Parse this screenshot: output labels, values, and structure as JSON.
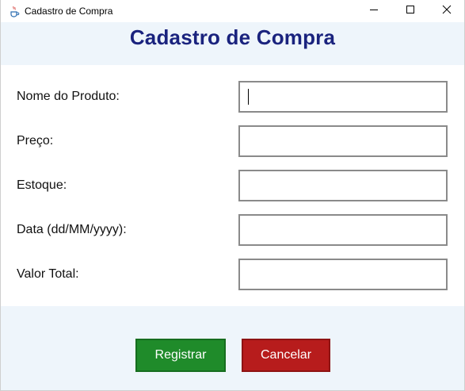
{
  "window": {
    "title": "Cadastro de Compra"
  },
  "header": {
    "title": "Cadastro de Compra"
  },
  "form": {
    "fields": [
      {
        "label": "Nome do Produto:",
        "value": ""
      },
      {
        "label": "Preço:",
        "value": ""
      },
      {
        "label": "Estoque:",
        "value": ""
      },
      {
        "label": "Data (dd/MM/yyyy):",
        "value": ""
      },
      {
        "label": "Valor Total:",
        "value": ""
      }
    ]
  },
  "buttons": {
    "register_label": "Registrar",
    "cancel_label": "Cancelar"
  },
  "colors": {
    "header_bg": "#eef5fb",
    "title_color": "#1a237e",
    "register_bg": "#1f8b2a",
    "cancel_bg": "#b71c1c"
  },
  "icons": {
    "app": "java-app-icon",
    "minimize": "minimize-icon",
    "maximize": "maximize-icon",
    "close": "close-icon"
  }
}
